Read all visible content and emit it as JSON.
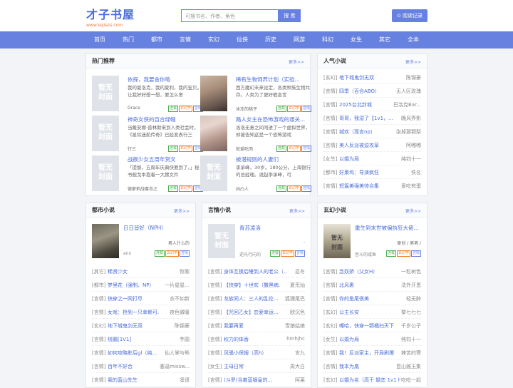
{
  "logo": {
    "title": "才子书屋",
    "url": "www.kejiezs.com"
  },
  "search": {
    "placeholder": "可搜书名、作者、角色",
    "button": "搜 索"
  },
  "read_record": "⊙ 阅读记录",
  "nav": [
    "首页",
    "热门",
    "都市",
    "言情",
    "玄幻",
    "仙侠",
    "历史",
    "网游",
    "科幻",
    "女生",
    "其它",
    "全本"
  ],
  "hot": {
    "title": "热门推荐",
    "more": "更多>>",
    "items": [
      {
        "title": "依探，我要舍你咯",
        "desc": "我的夏洛克，我的夏利，我的宝贝。让我好好想一想，要怎么舍",
        "author": "Grace",
        "cover": "暂无\n封面"
      },
      {
        "title": "稀有生物饲养计划（实验...",
        "desc": "西方魔幻未来设定，各类种族生物共存。人类为了更好栖息世",
        "author": "冰冻的桃子",
        "cover": ""
      },
      {
        "title": "神奇女侠的百合绿帽",
        "desc": "当戴安娜·普林斯来到人类社会时，《星际迷航传奇》已经发表行三",
        "author": "行三",
        "cover": "暂无\n封面"
      },
      {
        "title": "路人女主在恐怖游戏的通关...",
        "desc": "洛洛无意之间闯进了一个虚拟世界，却被告知这是一个恐怖游戏",
        "author": "就爱吃肉",
        "cover": ""
      },
      {
        "title": "战舰少女五周年贺文",
        "desc": "「提督，五周年庆典快要到了。」秘书舰戈本抱着一大摞文件",
        "author": "德萝莉战毒岛之",
        "cover": "暂无\n封面"
      },
      {
        "title": "被潜规则的人妻们",
        "desc": "李承峰，30岁。180公分。上海银行的总经理。说起李承峰，可",
        "author": "凶凸人",
        "cover": "暂无\n封面"
      }
    ],
    "tags": [
      "连载",
      "玄幻学",
      "言情"
    ]
  },
  "popular": {
    "title": "人气小说",
    "more": "更多>>",
    "items": [
      {
        "cat": "[玄幻]",
        "name": "地下城鬼剑无双",
        "author": "陈锦豪"
      },
      {
        "cat": "[言情]",
        "name": "四季（百合ABO）",
        "author": "无人区玫瑰"
      },
      {
        "cat": "[言情]",
        "name": "2025台北封城",
        "author": "巴洛克Bar..."
      },
      {
        "cat": "[言情]",
        "name": "哥哥，我湿了【1v1，...",
        "author": "晚风弄影"
      },
      {
        "cat": "[言情]",
        "name": "缄欢（现言np）",
        "author": "柒掉那颗梨"
      },
      {
        "cat": "[言情]",
        "name": "美人反派被迫攻草",
        "author": "阿嘟嘟"
      },
      {
        "cat": "[女生]",
        "name": "以婚为局",
        "author": "纯钧十一"
      },
      {
        "cat": "[都市]",
        "name": "好莱坞：导演疯狂",
        "author": "佚名"
      },
      {
        "cat": "[言情]",
        "name": "短篇美强美帅合集",
        "author": "爱吃煎蛋"
      }
    ]
  },
  "city": {
    "title": "都市小说",
    "more": "更多>>",
    "feat": {
      "title": "日日皆好（NPH）",
      "sub": "男人什么的",
      "author": "ann"
    },
    "items": [
      {
        "cat": "[其它]",
        "name": "稀贤少女",
        "author": "牧歌"
      },
      {
        "cat": "[都市]",
        "name": "梦里花（强制、NP）",
        "author": "一片星星..."
      },
      {
        "cat": "[言情]",
        "name": "快穿之一网打尽",
        "author": "衣不如新"
      },
      {
        "cat": "[言情]",
        "name": "女戏：抢到一只幸赖可...",
        "author": "夜色微暖"
      },
      {
        "cat": "[玄幻]",
        "name": "地下城鬼剑无双",
        "author": "陈锦豪"
      },
      {
        "cat": "[言情]",
        "name": "绕霸[1V1]",
        "author": "芋圆"
      },
      {
        "cat": "[言情]",
        "name": "如何攻略影后gl（纯...",
        "author": "仙人掌与熊"
      },
      {
        "cat": "[言情]",
        "name": "百年不好合",
        "author": "塞温missw..."
      },
      {
        "cat": "[言情]",
        "name": "我的蓝山先生",
        "author": "凛语"
      }
    ]
  },
  "romance": {
    "title": "言情小说",
    "more": "更多>>",
    "feat": {
      "title": "青苏凌洛",
      "sub": "-",
      "author": "逆光行向的"
    },
    "items": [
      {
        "cat": "[言情]",
        "name": "身体互换后睡到人的老公（...",
        "author": "忍冬"
      },
      {
        "cat": "[言情]",
        "name": "【快穿】十世欢（撒黑病...",
        "author": "夏荒灿"
      },
      {
        "cat": "[言情]",
        "name": "龙族同人：三人的乱伦...",
        "author": "狐狸尾巴"
      },
      {
        "cat": "[言情]",
        "name": "【咒回乙女】恋爱幸运...",
        "author": "欧沉色"
      },
      {
        "cat": "[言情]",
        "name": "我要再爱",
        "author": "雪狼姑娘"
      },
      {
        "cat": "[言情]",
        "name": "权力的体香",
        "author": "hmhjhc"
      },
      {
        "cat": "[言情]",
        "name": "风骚小保姆（高h）",
        "author": "言九"
      },
      {
        "cat": "[女生]",
        "name": "主母日常",
        "author": "周大白"
      },
      {
        "cat": "[言情]",
        "name": "(斗罗)当着蓝银皇的...",
        "author": "阿莱"
      }
    ]
  },
  "fantasy": {
    "title": "玄幻小说",
    "more": "更多>>",
    "feat": {
      "title": "重生到末世被偏执狂大佬...",
      "sub": "原创 / 男男 /",
      "author": "音斗的咸鱼"
    },
    "items": [
      {
        "cat": "[言情]",
        "name": "念奴娇（父女H）",
        "author": "一粒树色"
      },
      {
        "cat": "[言情]",
        "name": "北风裹",
        "author": "法外开恩"
      },
      {
        "cat": "[言情]",
        "name": "你的鱼尾很美",
        "author": "轻无醉"
      },
      {
        "cat": "[玄幻]",
        "name": "公主长安",
        "author": "黎七七七"
      },
      {
        "cat": "[玄幻]",
        "name": "嘴哈，快穿一颗橘扫天下",
        "author": "千岁公子"
      },
      {
        "cat": "[女生]",
        "name": "以婚为局",
        "author": "纯钧十一"
      },
      {
        "cat": "[言情]",
        "name": "我！反派家主，开局刷爆",
        "author": "辣苦的寒"
      },
      {
        "cat": "[言情]",
        "name": "我本为凰",
        "author": "昆山雅玉集"
      },
      {
        "cat": "[玄幻]",
        "name": "以婚为名（高干 婚恋 1v1 h）",
        "author": "吃吃一起"
      }
    ]
  }
}
